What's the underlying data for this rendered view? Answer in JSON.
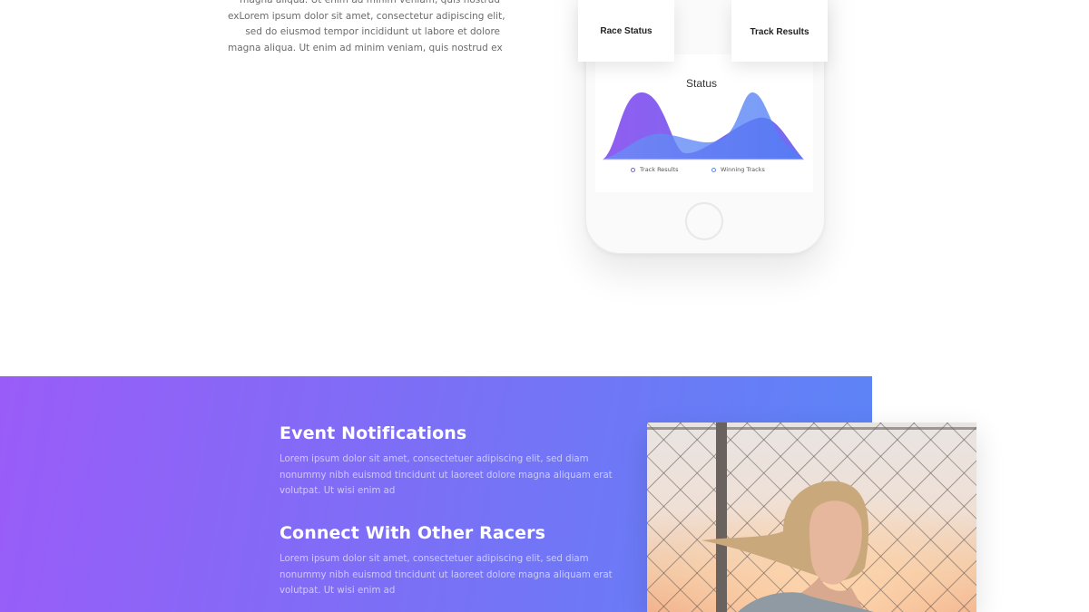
{
  "intro": {
    "paragraph_lines": [
      "magna aliqua. Ut enim ad minim veniam, quis nostrud",
      "exLorem ipsum dolor sit amet, consectetur adipiscing elit,",
      "sed do eiusmod tempor incididunt ut labore et dolore",
      "magna aliqua. Ut enim ad minim veniam, quis nostrud ex"
    ]
  },
  "phone": {
    "card_left_label": "Race Status",
    "card_right_label": "Track Results",
    "chart_title": "Status",
    "legend": [
      {
        "label": "Track Results",
        "color": "#7a5cf0"
      },
      {
        "label": "Winning Tracks",
        "color": "#5a86f5"
      }
    ]
  },
  "features": [
    {
      "title": "Event Notifications",
      "text_lines": [
        "Lorem ipsum dolor sit amet, consectetuer adipiscing elit, sed diam",
        "nonummy nibh euismod tincidunt ut laoreet dolore magna aliquam erat",
        "volutpat. Ut wisi enim ad"
      ]
    },
    {
      "title": "Connect With Other Racers",
      "text_lines": [
        "Lorem ipsum dolor sit amet, consectetuer adipiscing elit, sed diam",
        "nonummy nibh euismod tincidunt ut laoreet dolore magna aliquam erat",
        "volutpat. Ut wisi enim ad"
      ]
    }
  ],
  "colors": {
    "gradient_start": "#9a5cf8",
    "gradient_end": "#5b85f7",
    "series_purple": "#7a5cf0",
    "series_blue": "#5a86f5"
  }
}
